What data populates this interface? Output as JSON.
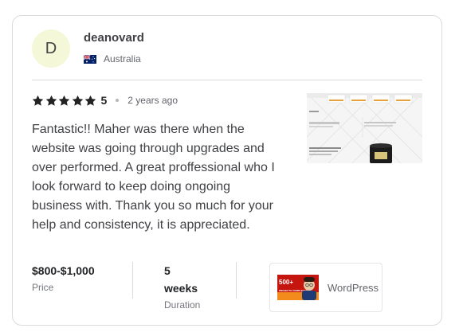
{
  "reviewer": {
    "initial": "D",
    "username": "deanovard",
    "country": "Australia"
  },
  "review": {
    "rating": 5,
    "rating_text": "5",
    "time_ago": "2 years ago",
    "text": "Fantastic!! Maher was there when the website was going through upgrades and over performed. A great proffessional who I look forward to keep doing ongoing business with. Thank you so much for your help and consistency, it is appreciated."
  },
  "stats": {
    "price_value": "$800-$1,000",
    "price_label": "Price",
    "duration_value_num": "5",
    "duration_value_unit": "weeks",
    "duration_label": "Duration"
  },
  "gig": {
    "category": "WordPress",
    "thumb_badge": "500+",
    "thumb_caption": "PROJECTS COMPLETED"
  },
  "colors": {
    "avatar_bg": "#f4f8d8",
    "star": "#222325",
    "gig_badge_bg": "#c4160f"
  },
  "icons": {
    "star": "star-icon",
    "flag": "australia-flag-icon"
  }
}
